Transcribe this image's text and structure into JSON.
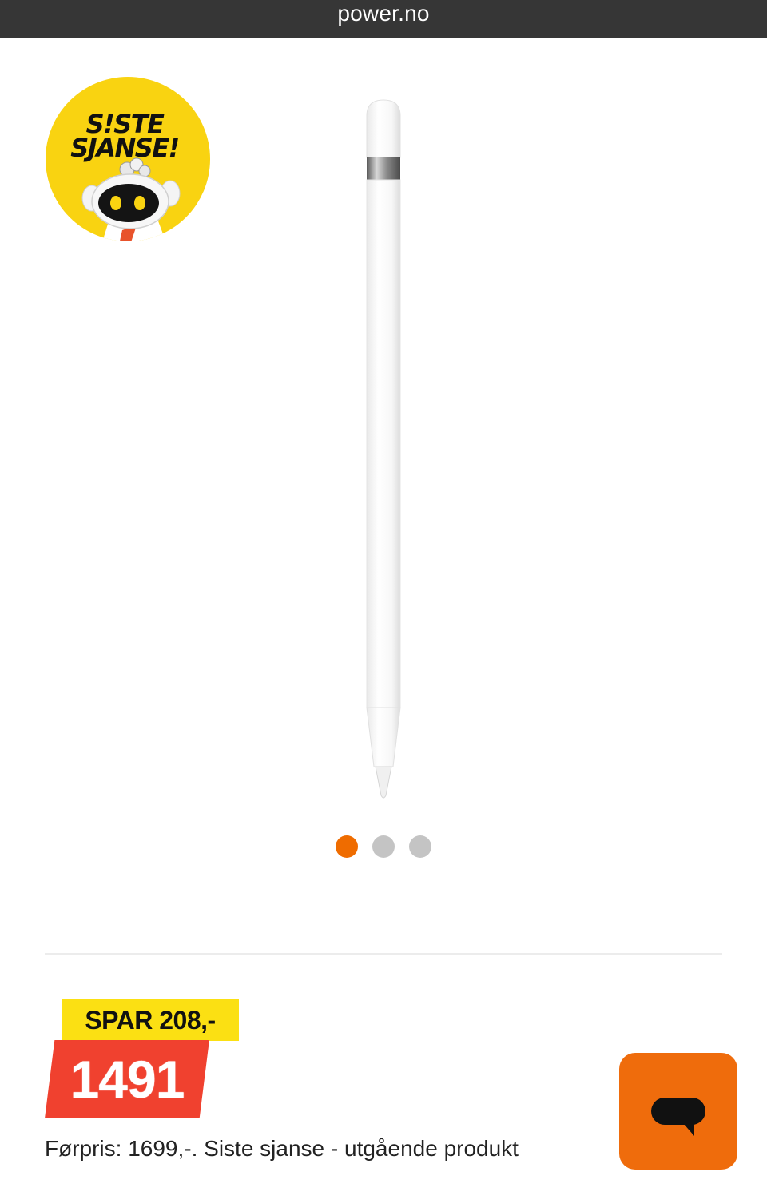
{
  "browser": {
    "domain": "power.no"
  },
  "promo_badge": {
    "line1": "S!STE",
    "line2": "SJANSE!",
    "color": "#f9d311"
  },
  "product": {
    "image_icon": "stylus-pencil-image",
    "carousel": {
      "count": 3,
      "active_index": 0,
      "active_color": "#ef6c00",
      "inactive_color": "#c4c4c4"
    }
  },
  "pricing": {
    "save_label": "SPAR 208,-",
    "price": "1491",
    "previous_price_text": "Førpris: 1699,-. Siste sjanse - utgående produkt",
    "save_color": "#fbe013",
    "price_color": "#f0412f"
  },
  "chat": {
    "icon": "chat-bubble-icon",
    "color": "#ef6c0c"
  }
}
